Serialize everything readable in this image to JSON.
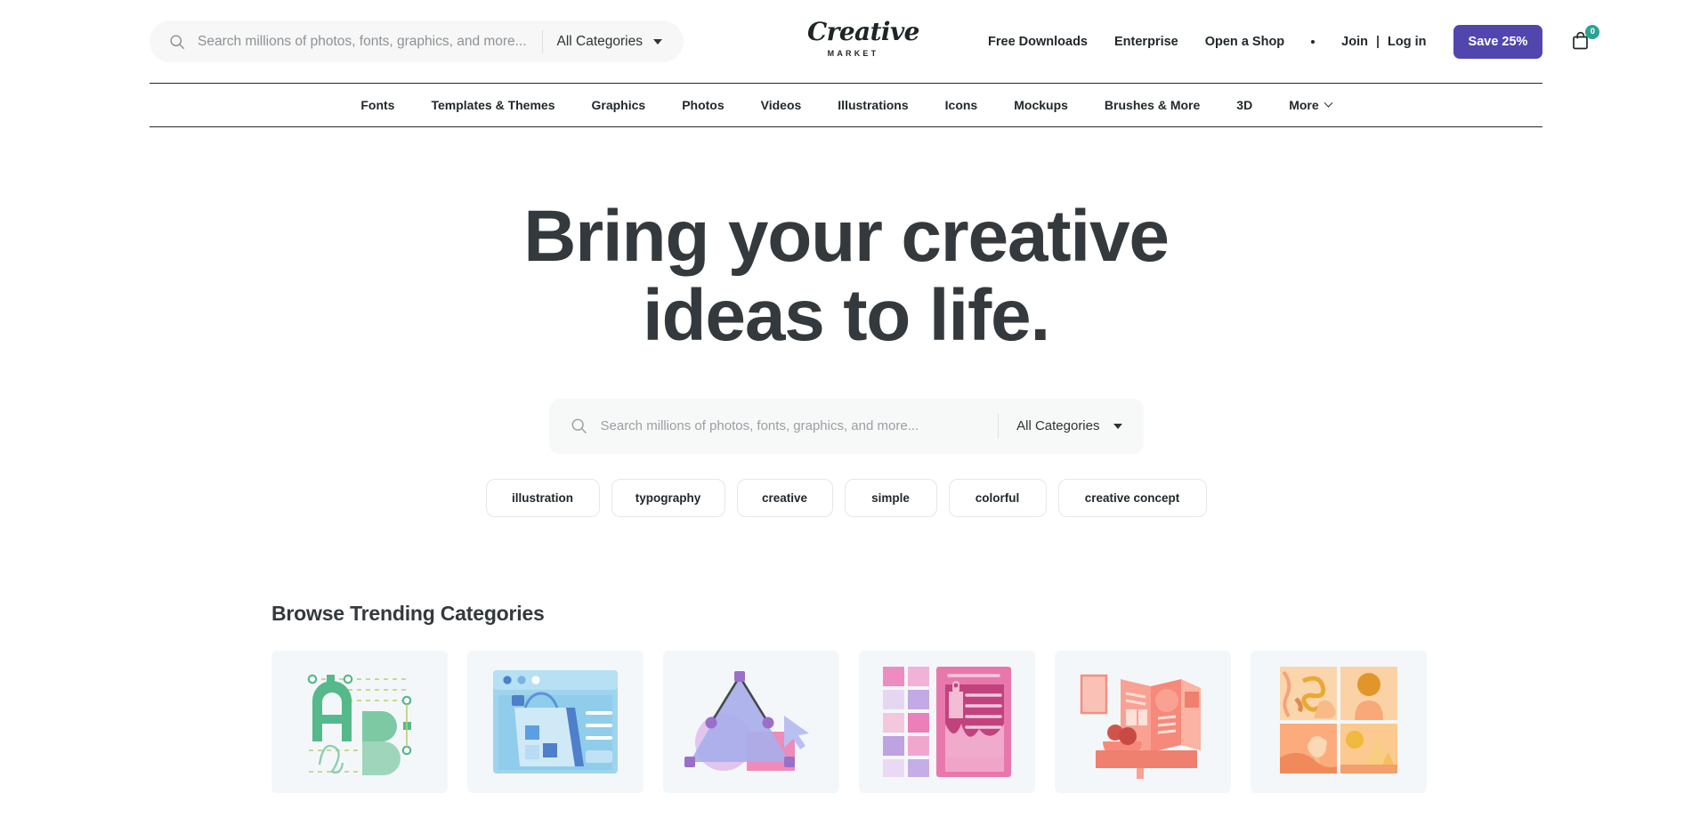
{
  "header": {
    "search": {
      "placeholder": "Search millions of photos, fonts, graphics, and more...",
      "value": "",
      "category_label": "All Categories",
      "icon": "search-icon"
    },
    "logo": {
      "word": "Creative",
      "sub": "MARKET"
    },
    "links": [
      {
        "label": "Free Downloads"
      },
      {
        "label": "Enterprise"
      },
      {
        "label": "Open a Shop"
      }
    ],
    "auth": {
      "join": "Join",
      "separator": "|",
      "login": "Log in"
    },
    "save_button": {
      "label": "Save 25%",
      "color": "#5046ad"
    },
    "cart": {
      "icon": "shopping-bag-icon",
      "badge_count": "0",
      "badge_color": "#2aa394"
    }
  },
  "nav": {
    "items": [
      {
        "label": "Fonts"
      },
      {
        "label": "Templates & Themes"
      },
      {
        "label": "Graphics"
      },
      {
        "label": "Photos"
      },
      {
        "label": "Videos"
      },
      {
        "label": "Illustrations"
      },
      {
        "label": "Icons"
      },
      {
        "label": "Mockups"
      },
      {
        "label": "Brushes & More"
      },
      {
        "label": "3D"
      },
      {
        "label": "More"
      }
    ]
  },
  "hero": {
    "headline_line1": "Bring your creative",
    "headline_line2": "ideas to life.",
    "search": {
      "placeholder": "Search millions of photos, fonts, graphics, and more...",
      "value": "",
      "category_label": "All Categories",
      "icon": "search-icon"
    },
    "tags": [
      {
        "label": "illustration"
      },
      {
        "label": "typography"
      },
      {
        "label": "creative"
      },
      {
        "label": "simple"
      },
      {
        "label": "colorful"
      },
      {
        "label": "creative concept"
      }
    ]
  },
  "trending": {
    "title": "Browse Trending Categories",
    "cards": [
      {
        "name": "fonts-card",
        "art": "letters-ab-green"
      },
      {
        "name": "templates-card",
        "art": "browser-shopping-blue"
      },
      {
        "name": "graphics-card",
        "art": "vector-triangle-purple"
      },
      {
        "name": "brushes-card",
        "art": "swatches-brush-pink"
      },
      {
        "name": "print-card",
        "art": "brochure-stand-coral"
      },
      {
        "name": "photos-card",
        "art": "photo-grid-orange"
      }
    ]
  }
}
